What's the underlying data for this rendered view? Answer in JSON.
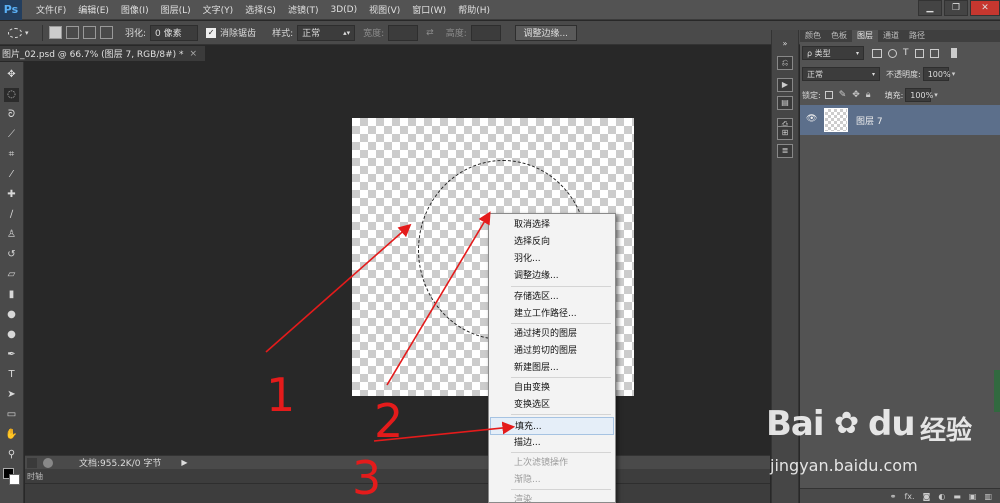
{
  "app": {
    "logo": "Ps"
  },
  "menubar": {
    "items": [
      "文件(F)",
      "编辑(E)",
      "图像(I)",
      "图层(L)",
      "文字(Y)",
      "选择(S)",
      "滤镜(T)",
      "3D(D)",
      "视图(V)",
      "窗口(W)",
      "帮助(H)"
    ],
    "window_controls": [
      "▁",
      "❐",
      "✕"
    ]
  },
  "optionsbar": {
    "feather_label": "羽化:",
    "feather_value": "0 像素",
    "antialias_label": "消除锯齿",
    "antialias_checked": true,
    "style_label": "样式:",
    "style_value": "正常",
    "width_label": "宽度:",
    "height_label": "高度:",
    "refine_edge_label": "调整边缘..."
  },
  "document": {
    "tab_title": "图片_02.psd @ 66.7% (图层 7, RGB/8#) *",
    "close": "×"
  },
  "statusbar": {
    "doc_info": "文档:955.2K/0 字节"
  },
  "bottom_tab": "时轴",
  "context_menu": {
    "items": [
      {
        "label": "取消选择",
        "disabled": false
      },
      {
        "label": "选择反向",
        "disabled": false
      },
      {
        "label": "羽化...",
        "disabled": false
      },
      {
        "label": "调整边缘...",
        "disabled": false
      },
      {
        "label": "存储选区...",
        "disabled": false
      },
      {
        "label": "建立工作路径...",
        "disabled": false
      },
      {
        "label": "通过拷贝的图层",
        "disabled": false
      },
      {
        "label": "通过剪切的图层",
        "disabled": false
      },
      {
        "label": "新建图层...",
        "disabled": false
      },
      {
        "label": "自由变换",
        "disabled": false
      },
      {
        "label": "变换选区",
        "disabled": false
      },
      {
        "label": "填充...",
        "disabled": false,
        "highlighted": true
      },
      {
        "label": "描边...",
        "disabled": false
      },
      {
        "label": "上次滤镜操作",
        "disabled": true
      },
      {
        "label": "渐隐...",
        "disabled": true
      },
      {
        "label": "渲染",
        "disabled": true
      }
    ]
  },
  "layers_panel": {
    "tabs": [
      "颜色",
      "色板",
      "图层",
      "通道",
      "路径"
    ],
    "active_tab": "图层",
    "filter_label": "ρ 类型",
    "blend_mode": "正常",
    "opacity_label": "不透明度:",
    "opacity_value": "100%",
    "lock_label": "锁定:",
    "fill_label": "填充:",
    "fill_value": "100%",
    "layers": [
      {
        "name": "图层 7",
        "visible": true,
        "selected": true
      }
    ],
    "footer_icons": [
      "link-icon",
      "fx-icon",
      "mask-icon",
      "adjustment-icon",
      "folder-icon",
      "new-layer-icon",
      "trash-icon"
    ]
  },
  "annotations": {
    "labels": [
      "1",
      "2",
      "3"
    ],
    "color": "#e41b1b"
  },
  "watermark": {
    "brand": "Bai",
    "brand_suffix": "du",
    "cn": "经验",
    "url": "jingyan.baidu.com"
  }
}
